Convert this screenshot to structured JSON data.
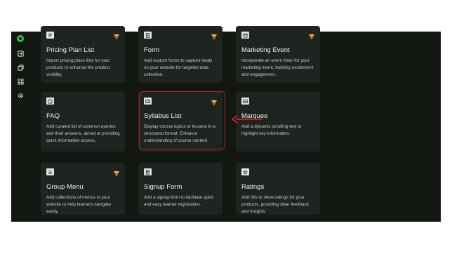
{
  "colors": {
    "background": "#121712",
    "card": "#1e2420",
    "brand_green": "#2dbf5a",
    "premium_orange": "#f2a33a",
    "annotation_red": "#b3262c"
  },
  "sidebar": {
    "icons": [
      "app-logo-icon",
      "box-arrow-icon",
      "copy-icon",
      "grid-icon",
      "settings-icon"
    ]
  },
  "cards": [
    {
      "id": "pricing-plan-list",
      "title": "Pricing Plan List",
      "desc": "Import pricing plans lists for your products to enhance the product visibility.",
      "icon": "list-doc-icon",
      "premium": true
    },
    {
      "id": "form",
      "title": "Form",
      "desc": "Add custom forms to capture leads on your website for targeted data collection.",
      "icon": "form-doc-icon",
      "premium": true
    },
    {
      "id": "marketing-event",
      "title": "Marketing Event",
      "desc": "Incorporate an event timer for your marketing event, building excitement and engagement.",
      "icon": "calendar-icon",
      "premium": true
    },
    {
      "id": "faq",
      "title": "FAQ",
      "desc": "Add curated list of common queries and their answers, aimed at providing quick information access.",
      "icon": "question-icon",
      "premium": false
    },
    {
      "id": "syllabus-list",
      "title": "Syllabus List",
      "desc": "Display course topics or lessons in a structured format. Enhance understanding of course content.",
      "icon": "list-box-icon",
      "premium": true
    },
    {
      "id": "marquee",
      "title": "Marquee",
      "desc": "Add a dynamic scrolling text to highlight key information.",
      "icon": "scroll-text-icon",
      "premium": false
    },
    {
      "id": "group-menu",
      "title": "Group Menu",
      "desc": "Add collections of menus to your website to help learners navigate easily.",
      "icon": "menu-icon",
      "premium": true
    },
    {
      "id": "signup-form",
      "title": "Signup Form",
      "desc": "Add a signup form to facilitate quick and easy learner registration.",
      "icon": "signup-doc-icon",
      "premium": false
    },
    {
      "id": "ratings",
      "title": "Ratings",
      "desc": "Add this to show ratings for your products, providing clear feedback and insights",
      "icon": "star-icon",
      "premium": false
    }
  ]
}
